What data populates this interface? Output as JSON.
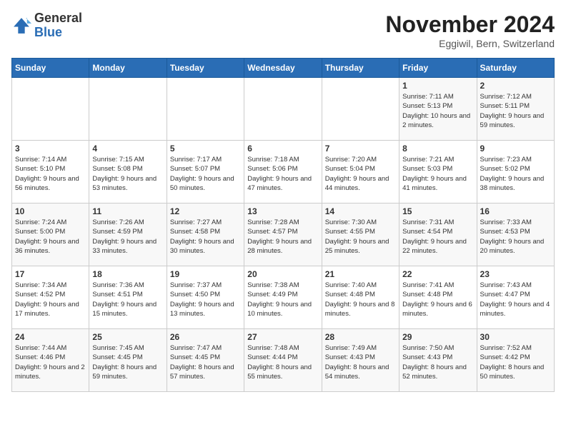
{
  "logo": {
    "general": "General",
    "blue": "Blue"
  },
  "header": {
    "month": "November 2024",
    "location": "Eggiwil, Bern, Switzerland"
  },
  "weekdays": [
    "Sunday",
    "Monday",
    "Tuesday",
    "Wednesday",
    "Thursday",
    "Friday",
    "Saturday"
  ],
  "weeks": [
    [
      {
        "day": "",
        "info": ""
      },
      {
        "day": "",
        "info": ""
      },
      {
        "day": "",
        "info": ""
      },
      {
        "day": "",
        "info": ""
      },
      {
        "day": "",
        "info": ""
      },
      {
        "day": "1",
        "info": "Sunrise: 7:11 AM\nSunset: 5:13 PM\nDaylight: 10 hours and 2 minutes."
      },
      {
        "day": "2",
        "info": "Sunrise: 7:12 AM\nSunset: 5:11 PM\nDaylight: 9 hours and 59 minutes."
      }
    ],
    [
      {
        "day": "3",
        "info": "Sunrise: 7:14 AM\nSunset: 5:10 PM\nDaylight: 9 hours and 56 minutes."
      },
      {
        "day": "4",
        "info": "Sunrise: 7:15 AM\nSunset: 5:08 PM\nDaylight: 9 hours and 53 minutes."
      },
      {
        "day": "5",
        "info": "Sunrise: 7:17 AM\nSunset: 5:07 PM\nDaylight: 9 hours and 50 minutes."
      },
      {
        "day": "6",
        "info": "Sunrise: 7:18 AM\nSunset: 5:06 PM\nDaylight: 9 hours and 47 minutes."
      },
      {
        "day": "7",
        "info": "Sunrise: 7:20 AM\nSunset: 5:04 PM\nDaylight: 9 hours and 44 minutes."
      },
      {
        "day": "8",
        "info": "Sunrise: 7:21 AM\nSunset: 5:03 PM\nDaylight: 9 hours and 41 minutes."
      },
      {
        "day": "9",
        "info": "Sunrise: 7:23 AM\nSunset: 5:02 PM\nDaylight: 9 hours and 38 minutes."
      }
    ],
    [
      {
        "day": "10",
        "info": "Sunrise: 7:24 AM\nSunset: 5:00 PM\nDaylight: 9 hours and 36 minutes."
      },
      {
        "day": "11",
        "info": "Sunrise: 7:26 AM\nSunset: 4:59 PM\nDaylight: 9 hours and 33 minutes."
      },
      {
        "day": "12",
        "info": "Sunrise: 7:27 AM\nSunset: 4:58 PM\nDaylight: 9 hours and 30 minutes."
      },
      {
        "day": "13",
        "info": "Sunrise: 7:28 AM\nSunset: 4:57 PM\nDaylight: 9 hours and 28 minutes."
      },
      {
        "day": "14",
        "info": "Sunrise: 7:30 AM\nSunset: 4:55 PM\nDaylight: 9 hours and 25 minutes."
      },
      {
        "day": "15",
        "info": "Sunrise: 7:31 AM\nSunset: 4:54 PM\nDaylight: 9 hours and 22 minutes."
      },
      {
        "day": "16",
        "info": "Sunrise: 7:33 AM\nSunset: 4:53 PM\nDaylight: 9 hours and 20 minutes."
      }
    ],
    [
      {
        "day": "17",
        "info": "Sunrise: 7:34 AM\nSunset: 4:52 PM\nDaylight: 9 hours and 17 minutes."
      },
      {
        "day": "18",
        "info": "Sunrise: 7:36 AM\nSunset: 4:51 PM\nDaylight: 9 hours and 15 minutes."
      },
      {
        "day": "19",
        "info": "Sunrise: 7:37 AM\nSunset: 4:50 PM\nDaylight: 9 hours and 13 minutes."
      },
      {
        "day": "20",
        "info": "Sunrise: 7:38 AM\nSunset: 4:49 PM\nDaylight: 9 hours and 10 minutes."
      },
      {
        "day": "21",
        "info": "Sunrise: 7:40 AM\nSunset: 4:48 PM\nDaylight: 9 hours and 8 minutes."
      },
      {
        "day": "22",
        "info": "Sunrise: 7:41 AM\nSunset: 4:48 PM\nDaylight: 9 hours and 6 minutes."
      },
      {
        "day": "23",
        "info": "Sunrise: 7:43 AM\nSunset: 4:47 PM\nDaylight: 9 hours and 4 minutes."
      }
    ],
    [
      {
        "day": "24",
        "info": "Sunrise: 7:44 AM\nSunset: 4:46 PM\nDaylight: 9 hours and 2 minutes."
      },
      {
        "day": "25",
        "info": "Sunrise: 7:45 AM\nSunset: 4:45 PM\nDaylight: 8 hours and 59 minutes."
      },
      {
        "day": "26",
        "info": "Sunrise: 7:47 AM\nSunset: 4:45 PM\nDaylight: 8 hours and 57 minutes."
      },
      {
        "day": "27",
        "info": "Sunrise: 7:48 AM\nSunset: 4:44 PM\nDaylight: 8 hours and 55 minutes."
      },
      {
        "day": "28",
        "info": "Sunrise: 7:49 AM\nSunset: 4:43 PM\nDaylight: 8 hours and 54 minutes."
      },
      {
        "day": "29",
        "info": "Sunrise: 7:50 AM\nSunset: 4:43 PM\nDaylight: 8 hours and 52 minutes."
      },
      {
        "day": "30",
        "info": "Sunrise: 7:52 AM\nSunset: 4:42 PM\nDaylight: 8 hours and 50 minutes."
      }
    ]
  ]
}
